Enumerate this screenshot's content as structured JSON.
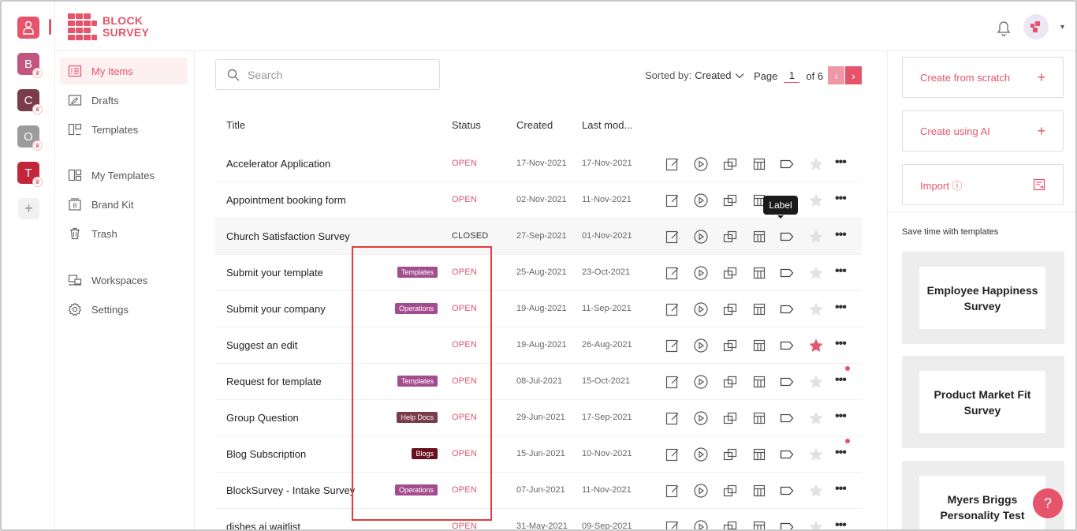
{
  "app": {
    "logo_line1": "BLOCK",
    "logo_line2": "SURVEY",
    "accent": "#e5546a"
  },
  "workspaces": [
    {
      "letter": "",
      "color": "#e5546a",
      "icon": "user-icon"
    },
    {
      "letter": "B",
      "color": "#c2567f"
    },
    {
      "letter": "C",
      "color": "#7a3b4a"
    },
    {
      "letter": "O",
      "color": "#9b9b9b"
    },
    {
      "letter": "T",
      "color": "#c2263b"
    }
  ],
  "workspace_add": "+",
  "nav": {
    "items": [
      {
        "label": "My Items",
        "icon": "my-items-icon"
      },
      {
        "label": "Drafts",
        "icon": "drafts-icon"
      },
      {
        "label": "Templates",
        "icon": "templates-icon"
      },
      {
        "label": "My Templates",
        "icon": "my-templates-icon"
      },
      {
        "label": "Brand Kit",
        "icon": "brand-kit-icon"
      },
      {
        "label": "Trash",
        "icon": "trash-icon"
      },
      {
        "label": "Workspaces",
        "icon": "workspaces-icon"
      },
      {
        "label": "Settings",
        "icon": "gear-icon"
      }
    ]
  },
  "toolbar": {
    "search_placeholder": "Search",
    "sorted_by_label": "Sorted by:",
    "sorted_by_value": "Created",
    "page_label": "Page",
    "page_current": "1",
    "page_total": "of 6",
    "prev": "‹",
    "next": "›"
  },
  "table": {
    "headers": {
      "title": "Title",
      "status": "Status",
      "created": "Created",
      "modified": "Last mod..."
    },
    "tooltip": "Label",
    "rows": [
      {
        "title": "Accelerator Application",
        "tag": "",
        "status": "OPEN",
        "created": "17-Nov-2021",
        "modified": "17-Nov-2021",
        "starred": false,
        "notify": false
      },
      {
        "title": "Appointment booking form",
        "tag": "",
        "status": "OPEN",
        "created": "02-Nov-2021",
        "modified": "11-Nov-2021",
        "starred": false,
        "notify": false
      },
      {
        "title": "Church Satisfaction Survey",
        "tag": "",
        "status": "CLOSED",
        "created": "27-Sep-2021",
        "modified": "01-Nov-2021",
        "starred": false,
        "notify": false
      },
      {
        "title": "Submit your template",
        "tag": "Templates",
        "tag_color": "#a34d8f",
        "status": "OPEN",
        "created": "25-Aug-2021",
        "modified": "23-Oct-2021",
        "starred": false,
        "notify": false
      },
      {
        "title": "Submit your company",
        "tag": "Operations",
        "tag_color": "#a34d8f",
        "status": "OPEN",
        "created": "19-Aug-2021",
        "modified": "11-Sep-2021",
        "starred": false,
        "notify": false
      },
      {
        "title": "Suggest an edit",
        "tag": "",
        "status": "OPEN",
        "created": "19-Aug-2021",
        "modified": "26-Aug-2021",
        "starred": true,
        "notify": false
      },
      {
        "title": "Request for template",
        "tag": "Templates",
        "tag_color": "#a34d8f",
        "status": "OPEN",
        "created": "08-Jul-2021",
        "modified": "15-Oct-2021",
        "starred": false,
        "notify": true
      },
      {
        "title": "Group Question",
        "tag": "Help Docs",
        "tag_color": "#7a3b4a",
        "status": "OPEN",
        "created": "29-Jun-2021",
        "modified": "17-Sep-2021",
        "starred": false,
        "notify": false
      },
      {
        "title": "Blog Subscription",
        "tag": "Blogs",
        "tag_color": "#6a0f1f",
        "status": "OPEN",
        "created": "15-Jun-2021",
        "modified": "10-Nov-2021",
        "starred": false,
        "notify": true
      },
      {
        "title": "BlockSurvey - Intake Survey",
        "tag": "Operations",
        "tag_color": "#a34d8f",
        "status": "OPEN",
        "created": "07-Jun-2021",
        "modified": "11-Nov-2021",
        "starred": false,
        "notify": false
      },
      {
        "title": "dishes ai waitlist",
        "tag": "",
        "status": "OPEN",
        "created": "31-May-2021",
        "modified": "09-Sep-2021",
        "starred": false,
        "notify": false
      }
    ]
  },
  "right_panel": {
    "create_scratch": "Create from scratch",
    "create_ai": "Create using AI",
    "import": "Import ⓘ",
    "save_time": "Save time with templates",
    "templates": [
      "Employee Happiness Survey",
      "Product Market Fit Survey",
      "Myers Briggs Personality Test"
    ]
  },
  "help_label": "?"
}
